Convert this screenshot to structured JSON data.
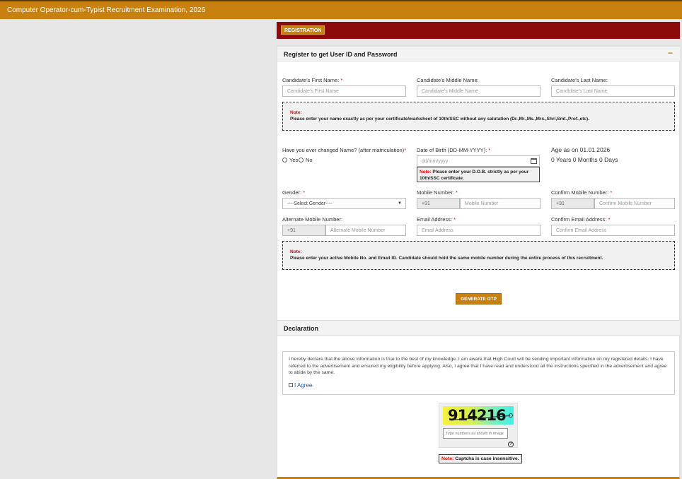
{
  "header": {
    "title": "Computer Operator-cum-Typist Recruitment Examination, 2026"
  },
  "nav": {
    "registration_tab": "REGISTRATION"
  },
  "section1": {
    "title": "Register to get User ID and Password",
    "collapse_symbol": "−"
  },
  "fields": {
    "first_name": {
      "label": "Candidate's First Name:",
      "placeholder": "Candidate's First Name"
    },
    "middle_name": {
      "label": "Candidate's Middle Name:",
      "placeholder": "Candidate's Middle Name"
    },
    "last_name": {
      "label": "Candidate's Last Name:",
      "placeholder": "Candidate's Last Name"
    },
    "changed_name": {
      "label": "Have you ever changed Name? (after matriculation)",
      "yes": "Yes",
      "no": "No"
    },
    "dob": {
      "label": "Date of Birth (DD-MM-YYYY):",
      "placeholder": "dd/mm/yyyy"
    },
    "age": {
      "label": "Age as on 01.01.2026",
      "value": "0 Years 0 Months 0 Days"
    },
    "gender": {
      "label": "Gender:",
      "selected": "----Select Gender----"
    },
    "mobile": {
      "label": "Mobile Number:",
      "prefix": "+91",
      "placeholder": "Mobile Number"
    },
    "confirm_mobile": {
      "label": "Confirm Mobile Number:",
      "prefix": "+91",
      "placeholder": "Confirm Mobile Number"
    },
    "alt_mobile": {
      "label": "Alternate Mobile Number:",
      "prefix": "+91",
      "placeholder": "Alternate Mobile Number"
    },
    "email": {
      "label": "Email Address:",
      "placeholder": "Email Address"
    },
    "confirm_email": {
      "label": "Confirm Email Address:",
      "placeholder": "Confirm Email Address"
    },
    "required_mark": "*"
  },
  "notes": {
    "note_label": "Note:",
    "name_note": "Please enter your name exactly as per your certificate/marksheet of 10th/SSC without any salutation (Dr.,Mr.,Ms.,Mrs.,Shri,Smt.,Prof.,etc).",
    "dob_note": "Please enter your D.O.B. strictly as per your 10th/SSC certificate.",
    "contact_note": "Please enter your active Mobile No. and Email ID. Candidate should hold the same mobile number during the entire process of this recruitment."
  },
  "buttons": {
    "generate_otp": "GENERATE OTP"
  },
  "declaration": {
    "title": "Declaration",
    "text": "I hereby declare that the above information is true to the best of my knowledge. I am aware that High Court will be sending important information on my registered details. I have referred to the advertisement and ensured my eligibility before applying. Also, I agree that I have read and understood all the instructions specified in the advertisement and agree to abide by the same.",
    "agree_label": "I Agree"
  },
  "captcha": {
    "code": "914216",
    "placeholder": "Type numbers as shown in image",
    "help": "?",
    "note": "Captcha is case insensitive."
  },
  "colors": {
    "accent": "#c8800e",
    "strip": "#8c0a0a",
    "required": "#e00000"
  }
}
